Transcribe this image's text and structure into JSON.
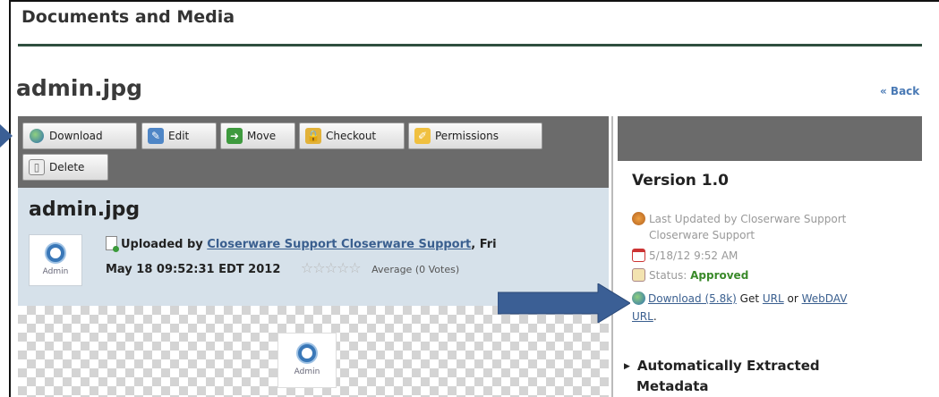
{
  "header": {
    "title": "Documents and Media"
  },
  "document": {
    "title": "admin.jpg",
    "back_label": "« Back"
  },
  "toolbar": {
    "download": "Download",
    "edit": "Edit",
    "move": "Move",
    "checkout": "Checkout",
    "permissions": "Permissions",
    "delete": "Delete"
  },
  "info": {
    "title": "admin.jpg",
    "thumb_label": "Admin",
    "uploaded_prefix": "Uploaded by ",
    "uploader": "Closerware Support Closerware Support",
    "date_part1": ", Fri",
    "date_part2": "May 18 09:52:31 EDT 2012",
    "stars": "☆☆☆☆☆",
    "average": "Average (0 Votes)"
  },
  "preview": {
    "thumb_label": "Admin"
  },
  "version_panel": {
    "version": "Version 1.0",
    "last_updated_line1": "Last Updated by Closerware Support",
    "last_updated_line2": "Closerware Support",
    "date": "5/18/12 9:52 AM",
    "status_label": "Status: ",
    "status_value": "Approved",
    "download_link": "Download (5.8k)",
    "get_text": " Get ",
    "url_link": "URL",
    "or_text": " or ",
    "webdav_link": "WebDAV",
    "webdav_url_link": "URL",
    "period": ".",
    "extracted_line1": "Automatically Extracted",
    "extracted_line2": "Metadata"
  },
  "colors": {
    "toolbar_bg": "#6b6b6b",
    "info_bg": "#d6e1ea",
    "arrow": "#3b5f95",
    "link": "#3a5f8f",
    "approved": "#3a8a2a"
  }
}
